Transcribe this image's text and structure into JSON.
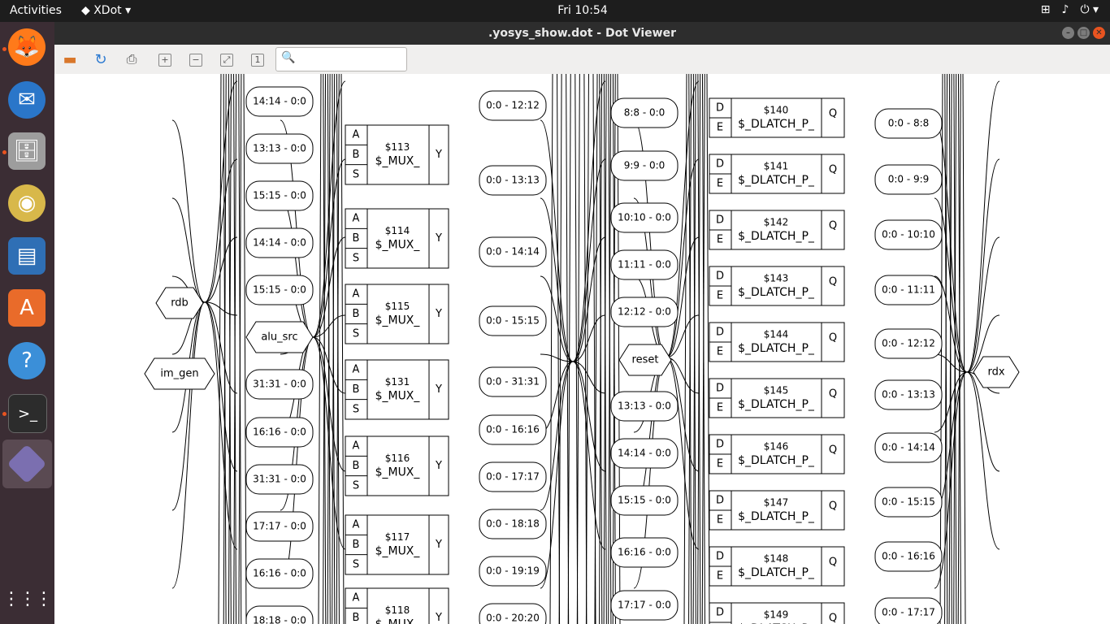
{
  "topbar": {
    "activities": "Activities",
    "app_name": "XDot",
    "clock": "Fri 10:54"
  },
  "window": {
    "title": ".yosys_show.dot - Dot Viewer"
  },
  "dock": {
    "apps": [
      "Firefox",
      "Thunderbird",
      "Files",
      "Rhythmbox",
      "LibreOffice Writer",
      "Ubuntu Software",
      "Help",
      "Terminal",
      "XDot",
      "Show Applications"
    ]
  },
  "toolbar": {
    "search_placeholder": ""
  },
  "graph": {
    "left_inputs": {
      "rdb": "rdb",
      "alu_src": "alu_src",
      "im_gen": "im_gen"
    },
    "slices_a": [
      "14:14 - 0:0",
      "13:13 - 0:0",
      "15:15 - 0:0",
      "14:14 - 0:0",
      "15:15 - 0:0",
      "31:31 - 0:0",
      "16:16 - 0:0",
      "31:31 - 0:0",
      "17:17 - 0:0",
      "16:16 - 0:0",
      "18:18 - 0:0"
    ],
    "muxes": [
      {
        "id": "$113",
        "type": "$_MUX_"
      },
      {
        "id": "$114",
        "type": "$_MUX_"
      },
      {
        "id": "$115",
        "type": "$_MUX_"
      },
      {
        "id": "$131",
        "type": "$_MUX_"
      },
      {
        "id": "$116",
        "type": "$_MUX_"
      },
      {
        "id": "$117",
        "type": "$_MUX_"
      },
      {
        "id": "$118",
        "type": "$_MUX_"
      }
    ],
    "mux_ports": {
      "a": "A",
      "b": "B",
      "s": "S",
      "y": "Y"
    },
    "slices_b": [
      "0:0 - 12:12",
      "0:0 - 13:13",
      "0:0 - 14:14",
      "0:0 - 15:15",
      "0:0 - 31:31",
      "0:0 - 16:16",
      "0:0 - 17:17",
      "0:0 - 18:18",
      "0:0 - 19:19",
      "0:0 - 20:20"
    ],
    "reset": "reset",
    "slices_c": [
      "8:8 - 0:0",
      "9:9 - 0:0",
      "10:10 - 0:0",
      "11:11 - 0:0",
      "12:12 - 0:0",
      "13:13 - 0:0",
      "14:14 - 0:0",
      "15:15 - 0:0",
      "16:16 - 0:0",
      "17:17 - 0:0"
    ],
    "latches": [
      {
        "id": "$140",
        "type": "$_DLATCH_P_"
      },
      {
        "id": "$141",
        "type": "$_DLATCH_P_"
      },
      {
        "id": "$142",
        "type": "$_DLATCH_P_"
      },
      {
        "id": "$143",
        "type": "$_DLATCH_P_"
      },
      {
        "id": "$144",
        "type": "$_DLATCH_P_"
      },
      {
        "id": "$145",
        "type": "$_DLATCH_P_"
      },
      {
        "id": "$146",
        "type": "$_DLATCH_P_"
      },
      {
        "id": "$147",
        "type": "$_DLATCH_P_"
      },
      {
        "id": "$148",
        "type": "$_DLATCH_P_"
      },
      {
        "id": "$149",
        "type": "$_DLATCH_P_"
      }
    ],
    "latch_ports": {
      "d": "D",
      "e": "E",
      "q": "Q"
    },
    "slices_d": [
      "0:0 - 8:8",
      "0:0 - 9:9",
      "0:0 - 10:10",
      "0:0 - 11:11",
      "0:0 - 12:12",
      "0:0 - 13:13",
      "0:0 - 14:14",
      "0:0 - 15:15",
      "0:0 - 16:16",
      "0:0 - 17:17"
    ],
    "output": "rdx"
  }
}
